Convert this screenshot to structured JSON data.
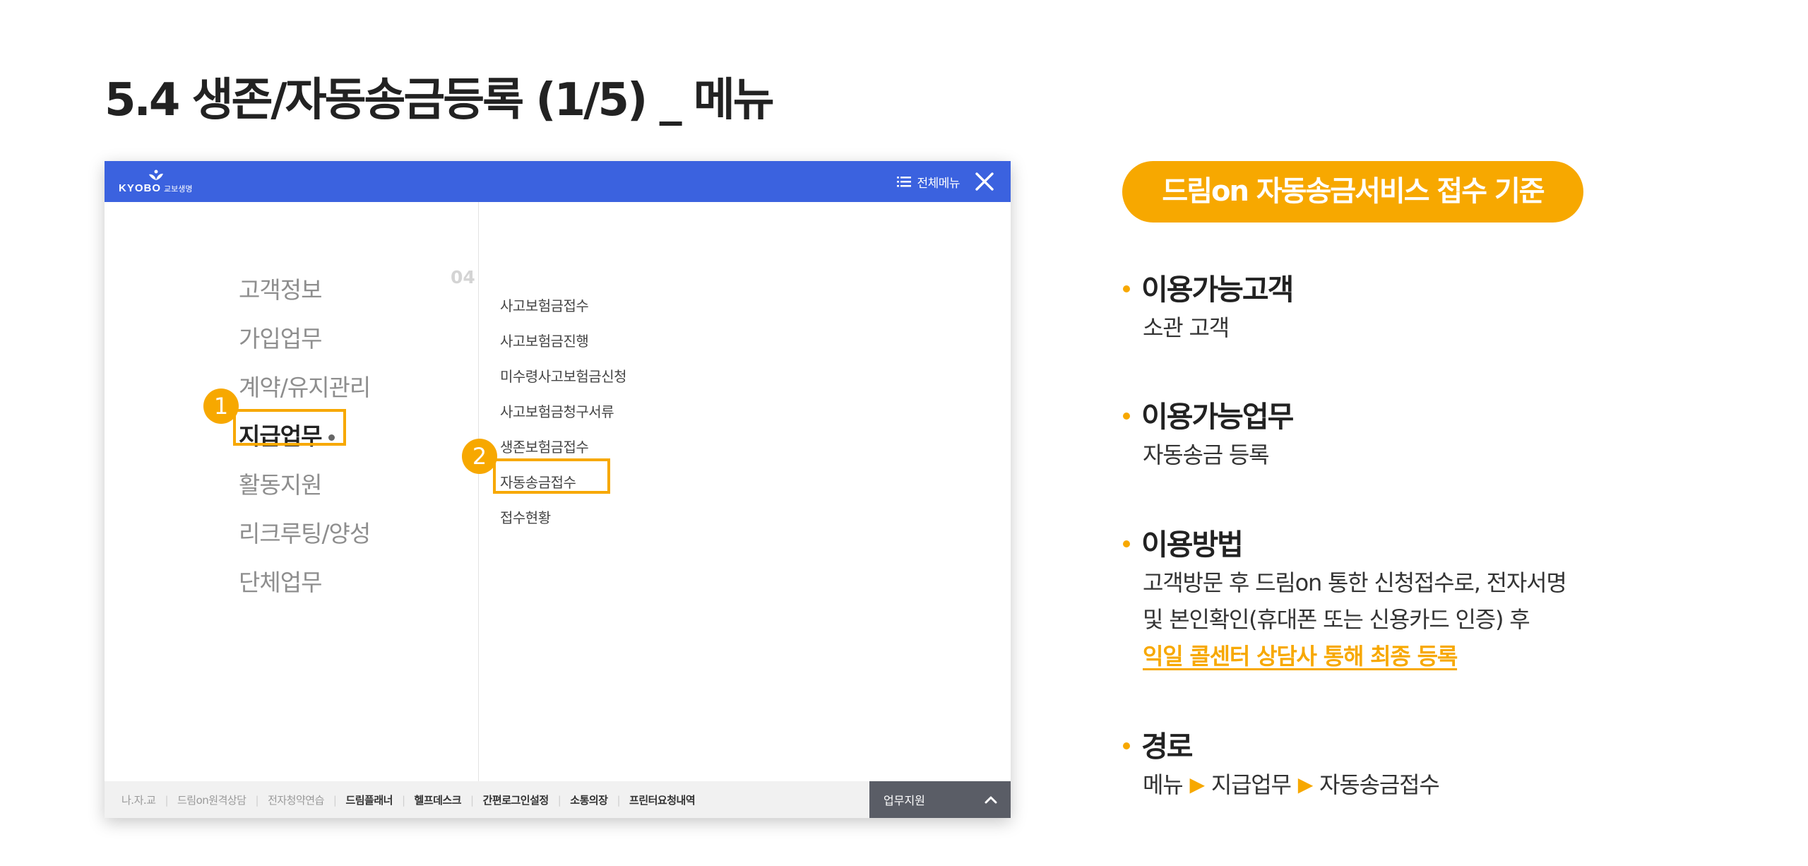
{
  "slide": {
    "title": "5.4 생존/자동송금등록 (1/5) _ 메뉴"
  },
  "app": {
    "header": {
      "logo_text": "KYOBO",
      "logo_sub": "교보생명",
      "menu_all_label": "전체메뉴",
      "color": "#3b62df"
    },
    "main_menu": {
      "section_number": "04",
      "items": [
        {
          "label": "고객정보"
        },
        {
          "label": "가입업무"
        },
        {
          "label": "계약/유지관리"
        },
        {
          "label": "지급업무",
          "active": true
        },
        {
          "label": "활동지원"
        },
        {
          "label": "리크루팅/양성"
        },
        {
          "label": "단체업무"
        }
      ]
    },
    "sub_menu": {
      "items": [
        {
          "label": "사고보험금접수"
        },
        {
          "label": "사고보험금진행"
        },
        {
          "label": "미수령사고보험금신청"
        },
        {
          "label": "사고보험금청구서류"
        },
        {
          "label": "생존보험금접수"
        },
        {
          "label": "자동송금접수",
          "highlighted": true
        },
        {
          "label": "접수현황"
        }
      ]
    },
    "footer": {
      "links": [
        {
          "label": "나.자.교",
          "bold": false
        },
        {
          "label": "드림on원격상담",
          "bold": false
        },
        {
          "label": "전자청약연습",
          "bold": false
        },
        {
          "label": "드림플래너",
          "bold": true
        },
        {
          "label": "헬프데스크",
          "bold": true
        },
        {
          "label": "간편로그인설정",
          "bold": true
        },
        {
          "label": "소통의장",
          "bold": true
        },
        {
          "label": "프린터요청내역",
          "bold": true
        }
      ],
      "work_support_label": "업무지원"
    },
    "annotations": {
      "step1": "1",
      "step2": "2",
      "highlight_color": "#f7a800"
    }
  },
  "criteria": {
    "title": "드림on 자동송금서비스 접수 기준",
    "customer": {
      "title": "이용가능고객",
      "text": "소관 고객"
    },
    "task": {
      "title": "이용가능업무",
      "text": "자동송금 등록"
    },
    "method": {
      "title": "이용방법",
      "line1": "고객방문 후 드림on 통한 신청접수로, 전자서명",
      "line2": "및 본인확인(휴대폰 또는 신용카드 인증) 후",
      "line3": "익일 콜센터 상담사 통해 최종 등록"
    },
    "path": {
      "title": "경로",
      "steps": [
        "메뉴",
        "지급업무",
        "자동송금접수"
      ]
    }
  }
}
